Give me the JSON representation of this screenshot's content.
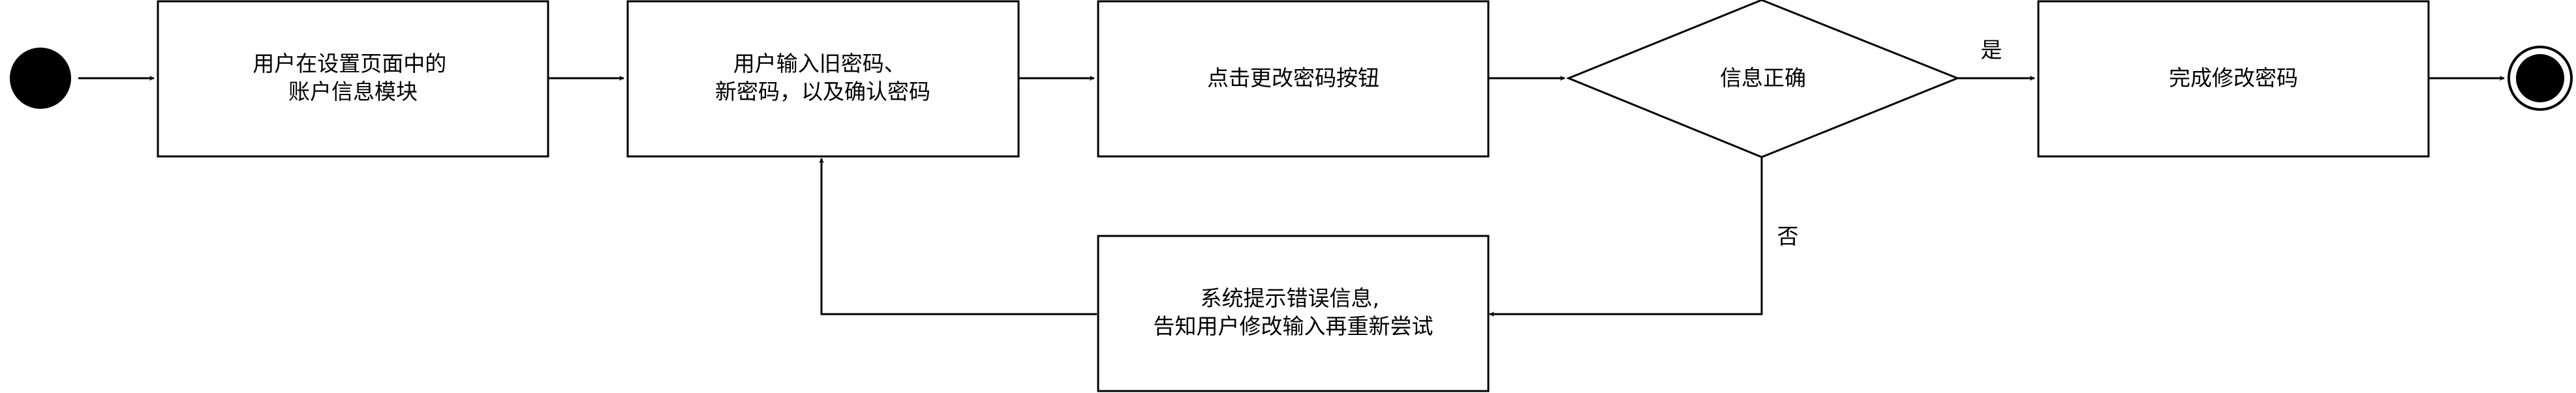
{
  "colors": {
    "stroke": "#000000",
    "fill": "#ffffff",
    "node_fill": "#000000",
    "text": "#000000"
  },
  "nodes": {
    "start": {
      "kind": "initial-node"
    },
    "step_open_account": {
      "kind": "action",
      "lines": [
        "用户在设置页面中的",
        "账户信息模块"
      ]
    },
    "step_input_passwords": {
      "kind": "action",
      "lines": [
        "用户输入旧密码、",
        "新密码，以及确认密码"
      ]
    },
    "step_click_change": {
      "kind": "action",
      "lines": [
        "点击更改密码按钮"
      ]
    },
    "decision_info_correct": {
      "kind": "decision",
      "label": "信息正确"
    },
    "step_done": {
      "kind": "action",
      "lines": [
        "完成修改密码"
      ]
    },
    "step_error": {
      "kind": "action",
      "lines": [
        "系统提示错误信息,",
        "告知用户修改输入再重新尝试"
      ]
    },
    "end": {
      "kind": "final-node"
    }
  },
  "edges": {
    "yes_label": "是",
    "no_label": "否"
  }
}
